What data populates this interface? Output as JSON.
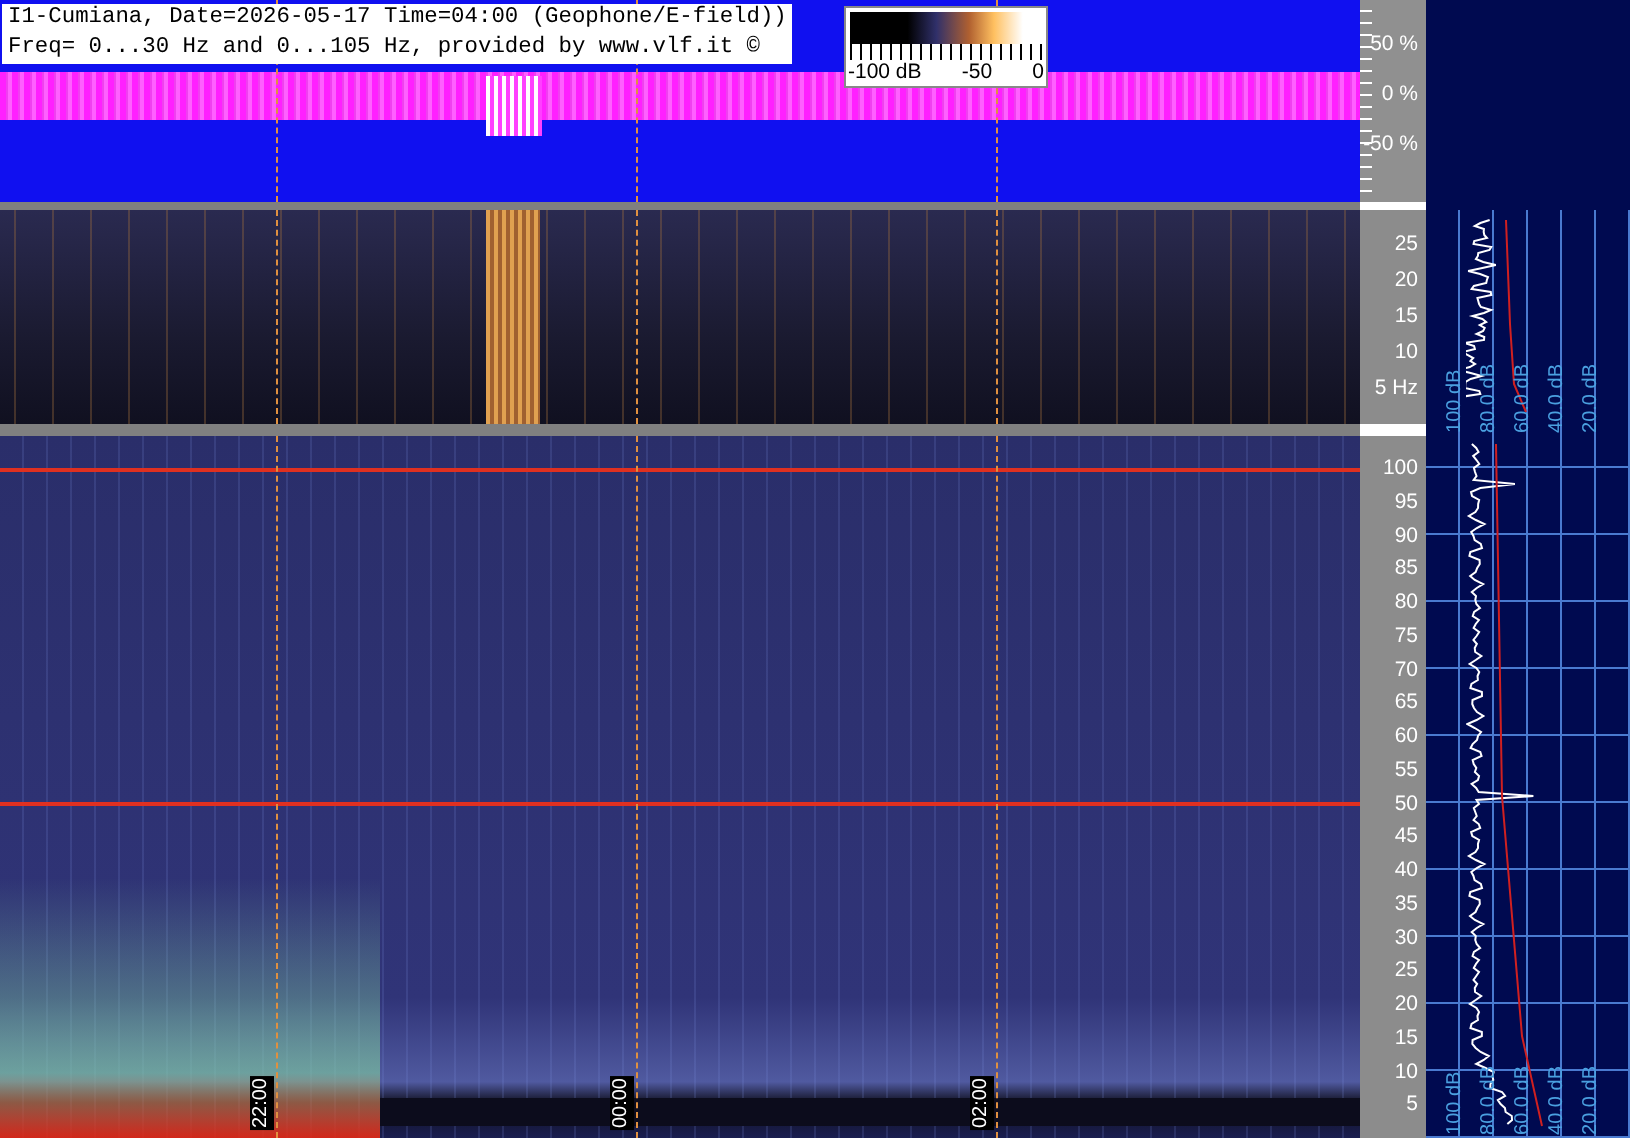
{
  "header": {
    "line_1": "I1-Cumiana, Date=2026-05-17 Time=04:00 (Geophone/E-field))",
    "line_2": "Freq= 0...30 Hz and 0...105 Hz, provided by www.vlf.it ©"
  },
  "colorbar": {
    "labels": [
      "-100 dB",
      "-50",
      "0"
    ]
  },
  "amplitude_axis": {
    "ticks": [
      "50 %",
      "0 %",
      "-50 %"
    ]
  },
  "low_freq_axis": {
    "ticks": [
      "25",
      "20",
      "15",
      "10",
      "5 Hz"
    ]
  },
  "high_freq_axis": {
    "ticks": [
      "100",
      "95",
      "90",
      "85",
      "80",
      "75",
      "70",
      "65",
      "60",
      "55",
      "50",
      "45",
      "40",
      "35",
      "30",
      "25",
      "20",
      "15",
      "10",
      "5"
    ]
  },
  "time_markers": [
    "22:00",
    "00:00",
    "02:00"
  ],
  "low_spectrum_scale": [
    "100 dB",
    "80.0 dB",
    "60.0 dB",
    "40.0 dB",
    "20.0 dB"
  ],
  "high_spectrum_scale": [
    "100 dB",
    "80.0 dB",
    "60.0 dB",
    "40.0 dB",
    "20.0 dB"
  ]
}
